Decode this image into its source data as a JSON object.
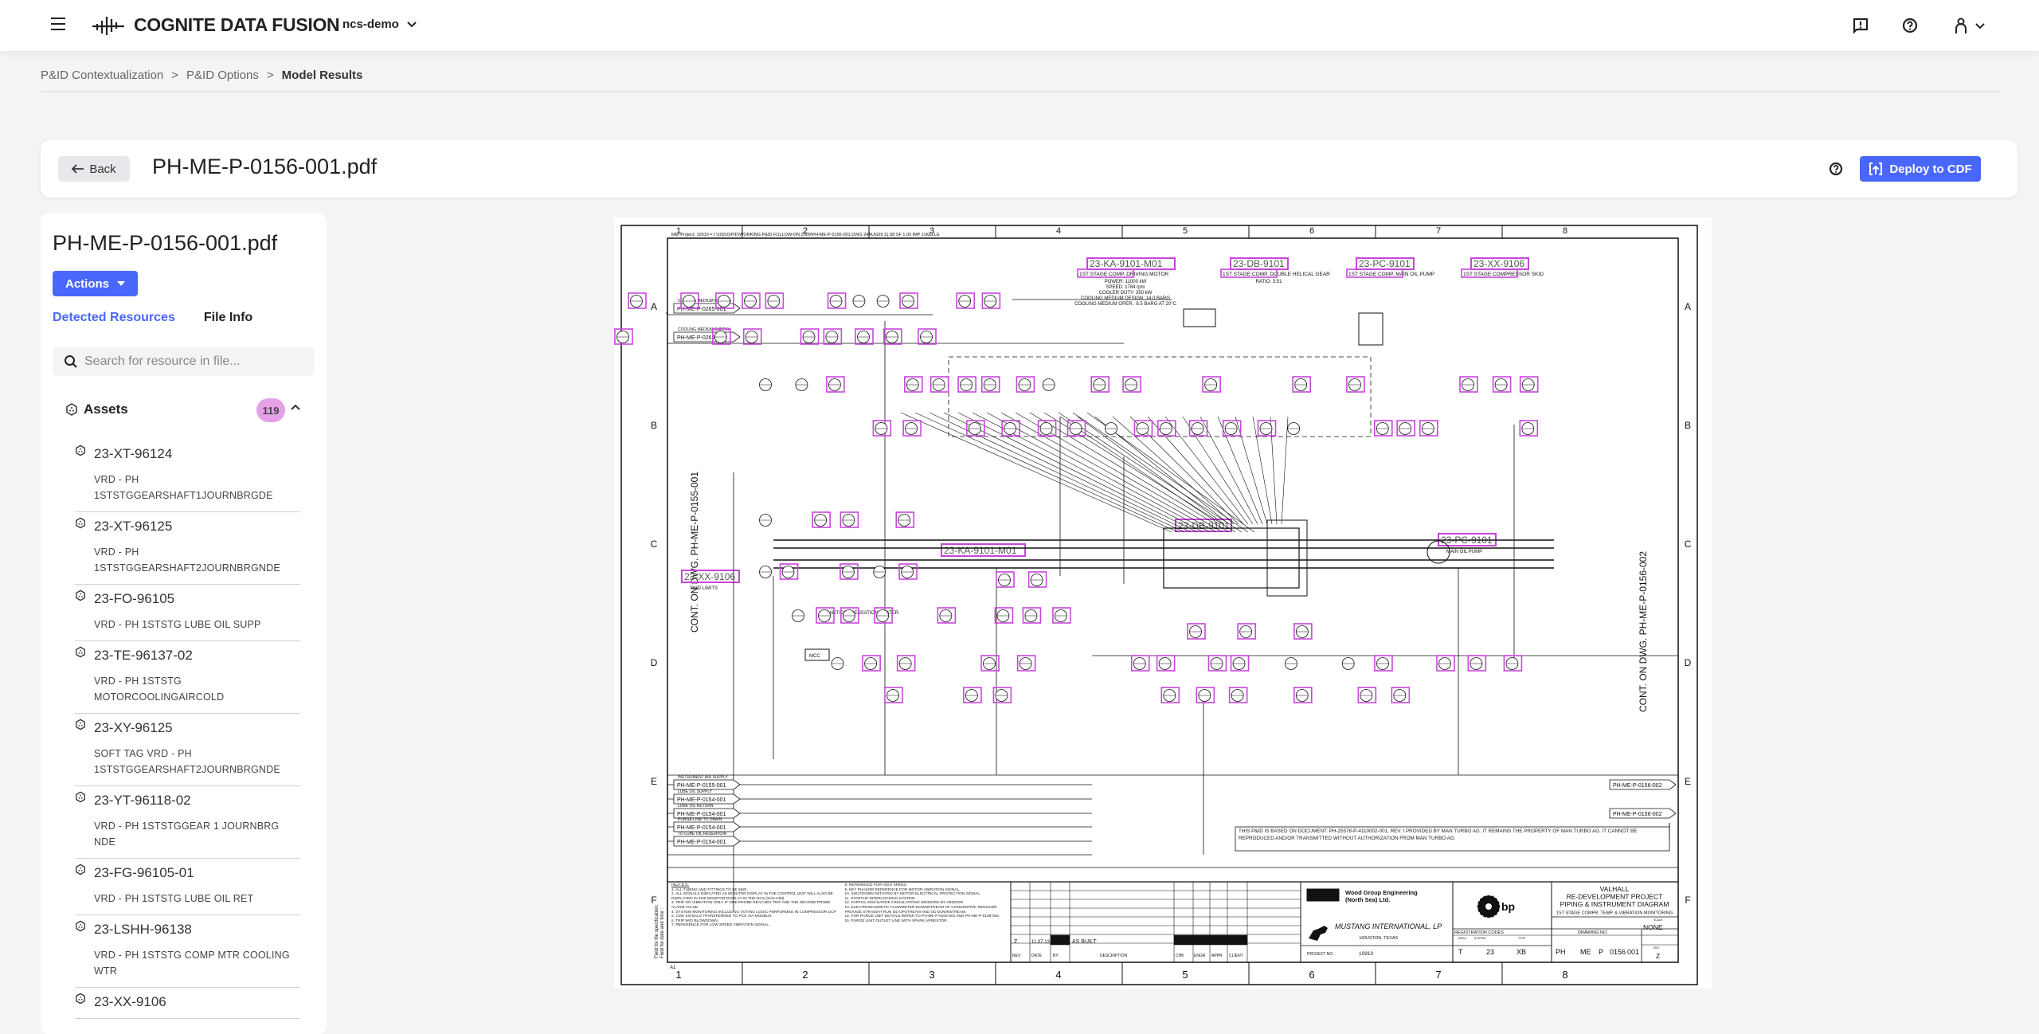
{
  "app": {
    "brand": "COGNITE DATA FUSION",
    "project": "ncs-demo"
  },
  "breadcrumb": [
    "P&ID Contextualization",
    "P&ID Options",
    "Model Results"
  ],
  "header": {
    "back_label": "Back",
    "file_title": "PH-ME-P-0156-001.pdf",
    "deploy_label": "Deploy to CDF"
  },
  "panel": {
    "title": "PH-ME-P-0156-001.pdf",
    "actions_label": "Actions",
    "tabs": [
      {
        "label": "Detected Resources",
        "active": true
      },
      {
        "label": "File Info",
        "active": false
      }
    ],
    "search_placeholder": "Search for resource in file...",
    "assets_label": "Assets",
    "assets_count": "119",
    "items": [
      {
        "name": "23-XT-96124",
        "desc": "VRD - PH 1STSTGGEARSHAFT1JOURNBRGDE"
      },
      {
        "name": "23-XT-96125",
        "desc": "VRD - PH 1STSTGGEARSHAFT2JOURNBRGNDE"
      },
      {
        "name": "23-FO-96105",
        "desc": "VRD - PH 1STSTG LUBE OIL SUPP"
      },
      {
        "name": "23-TE-96137-02",
        "desc": "VRD - PH 1STSTG MOTORCOOLINGAIRCOLD"
      },
      {
        "name": "23-XY-96125",
        "desc": "SOFT TAG VRD - PH 1STSTGGEARSHAFT2JOURNBRGNDE"
      },
      {
        "name": "23-YT-96118-02",
        "desc": "VRD - PH 1STSTGGEAR 1 JOURNBRG NDE"
      },
      {
        "name": "23-FG-96105-01",
        "desc": "VRD - PH 1STSTG LUBE OIL RET"
      },
      {
        "name": "23-LSHH-96138",
        "desc": "VRD - PH 1STSTG COMP MTR COOLING WTR"
      },
      {
        "name": "23-XX-9106",
        "desc": ""
      }
    ]
  },
  "drawing": {
    "highlight_color": "#c846dc",
    "header_line": "MEI Project: 10910 = I:\\10910\\PID\\WORKING P&ID FOLLOW-ON 2009\\PH-ME-P-0156-001.DWG 24AUG09 11:38 SF 1.00 IMP J1KELLE",
    "columns": [
      "1",
      "2",
      "3",
      "4",
      "5",
      "6",
      "7",
      "8"
    ],
    "rows": [
      "A",
      "B",
      "C",
      "D",
      "E",
      "F"
    ],
    "left_cont": "CONT. ON DWG. PH-ME-P-0155-001",
    "right_cont": "CONT. ON DWG. PH-ME-P-0156-002",
    "top_tags": [
      {
        "tag": "23-KA-9101-M01",
        "sub": "1ST STAGE COMP. DRIVING MOTOR",
        "spec": [
          "POWER: 11000 kW",
          "SPEED: 1784 rpm",
          "COOLER DUTY: 350 kW",
          "COOLING MEDIUM DESIGN: 14.0 BARG",
          "COOLING MEDIUM OPER.: 8.5 BARG AT 20°C"
        ]
      },
      {
        "tag": "23-DB-9101",
        "sub": "1ST STAGE COMP. DOUBLE HELICAL GEAR",
        "spec": [
          "RATIO: 3.51"
        ]
      },
      {
        "tag": "23-PC-9101",
        "sub": "1ST STAGE COMP. MAIN OIL PUMP",
        "spec": []
      },
      {
        "tag": "23-XX-9106",
        "sub": "1ST STAGE COMPRESSOR SKID",
        "spec": []
      }
    ],
    "inline_tags": [
      {
        "tag": "23-KA-9101-M01",
        "sub": ""
      },
      {
        "tag": "23-DB-9101",
        "sub": ""
      },
      {
        "tag": "23-PC-9101",
        "sub": "MAIN OIL PUMP"
      },
      {
        "tag": "23-XX-9106",
        "sub": "SKID LIMITS"
      }
    ],
    "line_refs": [
      "PH-ME-P-0265-001",
      "PH-ME-P-0265-001",
      "PH-ME-P-0155-001",
      "PH-ME-P-0154-001",
      "PH-ME-P-0154-001",
      "PH-ME-P-0154-001",
      "PH-ME-P-0154-001",
      "PH-ME-P-0156-002",
      "PH-ME-P-0156-002"
    ],
    "line_ref_titles": [
      "COOLING MEDIUM RETURN",
      "COOLING MEDIUM SUPPLY",
      "INSTRUMENT AIR SUPPLY",
      "LUBE OIL SUPPLY",
      "LUBE OIL RETURN",
      "PURGE LINE TO DRAIN",
      "TO LUBE OIL RESERVOIR"
    ],
    "misc_labels": [
      "ANTICONDENSATION HEATER",
      "MCC"
    ],
    "disclaimer": "THIS P&ID IS BASED ON DOCUMENT: PH-25578-P-4110002-001, REV. I PROVIDED BY MAN TURBO AG. IT REMAINS THE PROPERTY OF MAN TURBO AG. IT CANNOT BE REPRODUCED AND/OR TRANSMITTED WITHOUT AUTHORIZATION FROM MAN TURBO AG.",
    "notes_title": "NOTES:",
    "notes": [
      "1. ALL TUBING AND FITTINGS TO BE 6MO.",
      "2. ALL SIGNALS INDICATED AS MONITOR DISPLAY IN THE CONTROL UNIT WILL ALSO BE DISPLAYED IN THE MONITOR DISPLAY IN THE DCS (SAS-HMI)",
      "3. TRIP ON VIBRATION ONLY IF ONE PROBE REACHES TRIP AND THE SECOND PROBE ALARM VALUE.",
      "4. SYSTEM MONITORING INCLUDING VOTING LOGIC PERFORMED IN COMPRESSOR UCP",
      "5. CMS SIGNALS TRANSFERRED TO PCS VIA MODBUS.",
      "6. TRIP W/O BLOWDOWN.",
      "7. REFERENCE FOR LOW SPEED VIBRATION SIGNAL.",
      "8. REFERENCE FOR HIGH SPEED.",
      "9. KEY PHASOR REFERENCE FOR MOTOR VIBRATION SIGNAL.",
      "10. SHUTDOWN INITIATED BY MOTOR ELECTRICAL PROTECTION SIGNAL.",
      "11. STARTUP INTERLOCKING SYSTEM.",
      "12. PARTIAL DISCHARGE CINSULATIONO SENSORS BY VENDOR.",
      "13. ELECTROMAGNETIC FLOWMETER DOWNSTREAM OF CONCENTRIC REDUCER. PROVIDE STRAIGHT RUN OD UPSTREAM AND OD DOWNSTREAM.",
      "14. FOR PURGE UNIT DETAILS REFER TO PH-ME-P-0100-001 AND PH-ME-P-0108-002.",
      "15. PURGE UNIT OUTLET LINE WITH SPARK ARRESTOR."
    ],
    "side_note": [
      "Field for file specification:",
      "Field for date and time :"
    ],
    "sheet_size": "A1",
    "revision": {
      "rev": "Z",
      "date": "11.07.13",
      "description": "AS BUILT",
      "headers": [
        "REV",
        "DATE",
        "BY",
        "DESCRIPTION",
        "CHK",
        "ENGR",
        "APPR",
        "CLIENT"
      ]
    },
    "company": {
      "name1": "Wood Group Engineering",
      "name2": "(North Sea) Ltd.",
      "partner": "MUSTANG INTERNATIONAL, LP",
      "location": "HOUSTON, TEXAS",
      "project_no_label": "PROJECT NO.",
      "project_no": "10910",
      "client": "bp"
    },
    "title_block": {
      "lines": [
        "VALHALL",
        "RE-DEVELOPMENT PROJECT",
        "PIPING & INSTRUMENT DIAGRAM",
        "1ST STAGE COMPR. TEMP. & VIBRATION MONITORING"
      ],
      "registration_label": "REGISTRATION CODES",
      "area_label": "AREA",
      "system_label": "SYSTEM",
      "type_label": "TYPE",
      "area": "T",
      "system": "23",
      "type": "XB",
      "drawing_no_label": "DRAWING NO.",
      "facility": "PH",
      "discipline": "ME",
      "doc_type": "P",
      "seq": "0156",
      "sheet": "001",
      "scale_label": "SCALE",
      "scale": "NONE",
      "rev_label": "REV.",
      "rev": "Z"
    }
  }
}
